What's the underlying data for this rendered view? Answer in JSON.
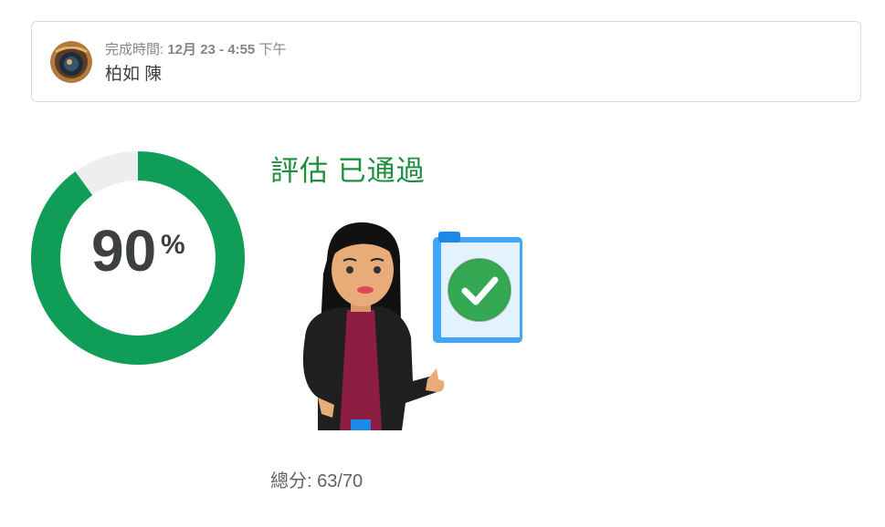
{
  "submission": {
    "completed_label": "完成時間:",
    "month": "12月",
    "day": "23",
    "sep": "-",
    "time": "4:55",
    "ampm": "下午",
    "student_name": "柏如 陳"
  },
  "result": {
    "percent": 90,
    "percent_text": "90",
    "percent_sign": "%",
    "status_text": "評估 已通過",
    "score_label": "總分:",
    "score_value": "63/70"
  },
  "colors": {
    "pass_green": "#0f9d58",
    "track_grey": "#eeeeee",
    "status_green": "#1e8e3e",
    "clipboard_blue": "#42a5f5"
  }
}
